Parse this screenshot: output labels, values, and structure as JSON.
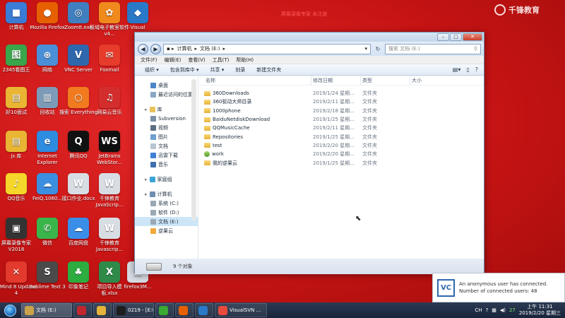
{
  "desktop": {
    "caption": "屏幕录像专家 未注册",
    "watermark": "千锋教育",
    "icons": [
      {
        "label": "计算机",
        "color": "#3a7bd5",
        "glyph": "■"
      },
      {
        "label": "Mozilla Firefox",
        "color": "#e66000",
        "glyph": "●"
      },
      {
        "label": "ZoomIt.exe",
        "color": "#3f7fbf",
        "glyph": "◎"
      },
      {
        "label": "极域电子教室软件 v4...",
        "color": "#f08a1d",
        "glyph": "✿"
      },
      {
        "label": "Visual",
        "color": "#2a78c8",
        "glyph": "◆"
      },
      {
        "label": "2345看图王",
        "color": "#3aa54b",
        "glyph": "图"
      },
      {
        "label": "网络",
        "color": "#4a8fd8",
        "glyph": "⊕"
      },
      {
        "label": "VNC Server",
        "color": "#2f67ad",
        "glyph": "V"
      },
      {
        "label": "Foxmail",
        "color": "#e73b2b",
        "glyph": "✉"
      },
      {
        "label": "好10面试",
        "color": "#e9b533",
        "glyph": "▤"
      },
      {
        "label": "回收站",
        "color": "#7d9bb8",
        "glyph": "▥"
      },
      {
        "label": "搜索 Everything",
        "color": "#f27b1f",
        "glyph": "○"
      },
      {
        "label": "网易云音乐",
        "color": "#d42d2d",
        "glyph": "♫"
      },
      {
        "label": "js 库",
        "color": "#e9b533",
        "glyph": "▤"
      },
      {
        "label": "Internet Explorer",
        "color": "#2d8be0",
        "glyph": "e"
      },
      {
        "label": "腾讯QQ",
        "color": "#111111",
        "glyph": "Q"
      },
      {
        "label": "JetBrains WebStor...",
        "color": "#0f0f0f",
        "glyph": "WS"
      },
      {
        "label": "QQ音乐",
        "color": "#f5d62a",
        "glyph": "♪"
      },
      {
        "label": "FeiQ.1060...",
        "color": "#3c8fe0",
        "glyph": "☁"
      },
      {
        "label": "接口作业.docx",
        "color": "#d8dde4",
        "glyph": "W"
      },
      {
        "label": "千锋教育 JavaScrip...",
        "color": "#d8dde4",
        "glyph": "W"
      },
      {
        "label": "屏幕录像专家V2018",
        "color": "#333333",
        "glyph": "▣"
      },
      {
        "label": "微信",
        "color": "#3ab54a",
        "glyph": "✆"
      },
      {
        "label": "百度网盘",
        "color": "#3b8ee8",
        "glyph": "☁"
      },
      {
        "label": "千锋教育 Javascrip...",
        "color": "#d8dde4",
        "glyph": "W"
      },
      {
        "label": "XMind 8 Update 4",
        "color": "#e23a2c",
        "glyph": "✕"
      },
      {
        "label": "Sublime Text 3",
        "color": "#4a4a4a",
        "glyph": "S"
      },
      {
        "label": "印象笔记",
        "color": "#2dac3f",
        "glyph": "♣"
      },
      {
        "label": "项目导入模板.xlsx",
        "color": "#2f8a4a",
        "glyph": "X"
      },
      {
        "label": "firefox3M...",
        "color": "#d8dde4",
        "glyph": "▤"
      }
    ]
  },
  "explorer": {
    "breadcrumb": [
      "计算机",
      "文档 (E:)"
    ],
    "search_placeholder": "搜索 文档 (E:)",
    "menu": [
      "文件(F)",
      "编辑(E)",
      "查看(V)",
      "工具(T)",
      "帮助(H)"
    ],
    "toolbar": [
      "组织 ▾",
      "包含到库中 ▾",
      "共享 ▾",
      "刻录",
      "新建文件夹"
    ],
    "nav": [
      {
        "label": "桌面",
        "icon": "desktop-icon",
        "color": "#4d86c7",
        "group": false
      },
      {
        "label": "最近访问的位置",
        "icon": "recent-icon",
        "color": "#8aa7c4",
        "group": false
      },
      {
        "gap": true
      },
      {
        "label": "库",
        "icon": "library-icon",
        "color": "#e8c25a",
        "group": true
      },
      {
        "label": "Subversion",
        "icon": "svn-icon",
        "color": "#7a8fa6",
        "group": false
      },
      {
        "label": "视频",
        "icon": "video-icon",
        "color": "#5d6e82",
        "group": false
      },
      {
        "label": "图片",
        "icon": "picture-icon",
        "color": "#6d9fd0",
        "group": false
      },
      {
        "label": "文档",
        "icon": "documents-icon",
        "color": "#b8c4d0",
        "group": false
      },
      {
        "label": "迅雷下载",
        "icon": "thunder-icon",
        "color": "#3d7fd3",
        "group": false
      },
      {
        "label": "音乐",
        "icon": "music-icon",
        "color": "#3e70b0",
        "group": false
      },
      {
        "gap": true
      },
      {
        "label": "家庭组",
        "icon": "homegroup-icon",
        "color": "#3aa4d6",
        "group": true
      },
      {
        "gap": true
      },
      {
        "label": "计算机",
        "icon": "computer-icon",
        "color": "#6f8fb2",
        "group": true
      },
      {
        "label": "系统 (C:)",
        "icon": "drive-icon",
        "color": "#9aa8b6",
        "group": false
      },
      {
        "label": "软件 (D:)",
        "icon": "drive-icon",
        "color": "#9aa8b6",
        "group": false
      },
      {
        "label": "文档 (E:)",
        "icon": "drive-icon",
        "color": "#9aa8b6",
        "group": false,
        "selected": true
      },
      {
        "label": "逆果云",
        "icon": "cloud-icon",
        "color": "#f0a93a",
        "group": false
      }
    ],
    "columns": {
      "name": "名称",
      "date": "修改日期",
      "type": "类型",
      "size": "大小"
    },
    "files": [
      {
        "name": "360Downloads",
        "date": "2019/1/24 星期...",
        "type": "文件夹",
        "kind": "folder"
      },
      {
        "name": "360驱动大师目录",
        "date": "2019/2/11 星期...",
        "type": "文件夹",
        "kind": "folder"
      },
      {
        "name": "1000phone",
        "date": "2019/2/18 星期...",
        "type": "文件夹",
        "kind": "folder"
      },
      {
        "name": "BaiduNetdiskDownload",
        "date": "2019/1/25 星期...",
        "type": "文件夹",
        "kind": "folder"
      },
      {
        "name": "QQMusicCache",
        "date": "2019/2/11 星期...",
        "type": "文件夹",
        "kind": "folder"
      },
      {
        "name": "Repositories",
        "date": "2019/1/25 星期...",
        "type": "文件夹",
        "kind": "folder"
      },
      {
        "name": "test",
        "date": "2019/2/20 星期...",
        "type": "文件夹",
        "kind": "folder"
      },
      {
        "name": "work",
        "date": "2019/2/20 星期...",
        "type": "文件夹",
        "kind": "work"
      },
      {
        "name": "我的逆果云",
        "date": "2019/1/25 星期...",
        "type": "文件夹",
        "kind": "folder"
      }
    ],
    "status": "9 个对象"
  },
  "notification": {
    "line1": "An anonymous user has connected.",
    "line2": "Number of connected users: 48"
  },
  "taskbar": {
    "items": [
      {
        "label": "文档 (E:)",
        "color": "#c9a24a",
        "active": true
      },
      {
        "label": "",
        "color": "#c2272d",
        "active": false
      },
      {
        "label": "",
        "color": "#e6b33a",
        "active": false
      },
      {
        "label": "0219 - [E:\\...",
        "color": "#1e1e1e",
        "active": false
      },
      {
        "label": "",
        "color": "#3aa832",
        "active": false
      },
      {
        "label": "",
        "color": "#e66000",
        "active": false
      },
      {
        "label": "",
        "color": "#2a78c8",
        "active": false
      },
      {
        "label": "VisualSVN ...",
        "color": "#e84b3c",
        "active": false
      }
    ],
    "tray_text": "CH",
    "tray_badge": "27",
    "time": "上午 11:31",
    "date": "2019/2/20 星期三"
  }
}
